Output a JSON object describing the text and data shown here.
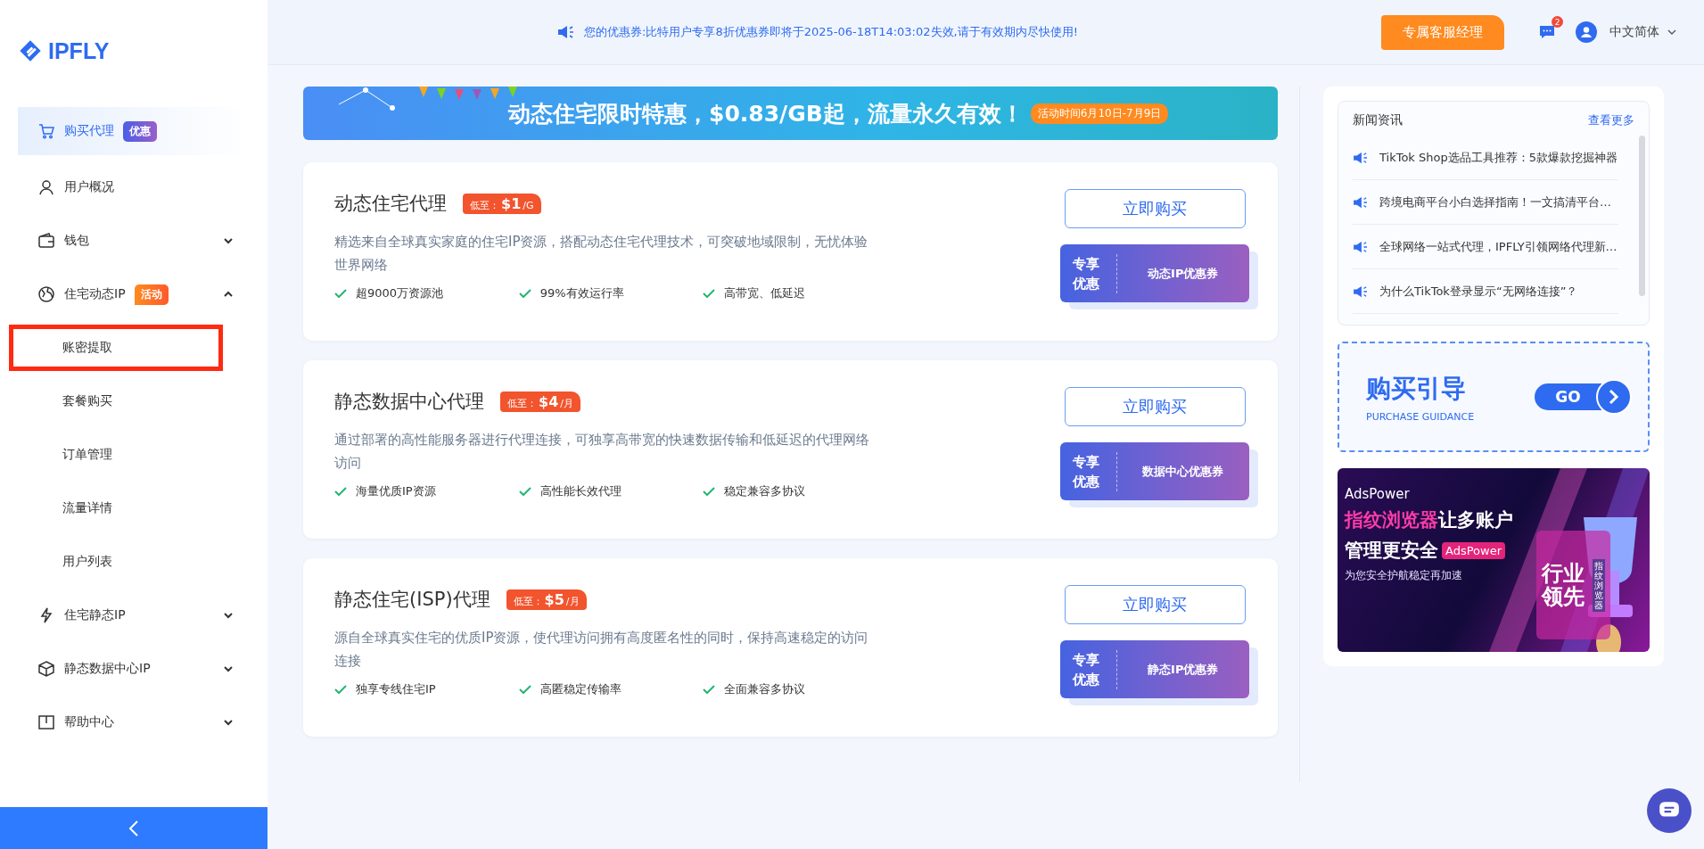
{
  "logo": {
    "text": "IPFLY"
  },
  "sidebar": {
    "items": [
      {
        "kind": "link",
        "label": "购买代理",
        "selected": true,
        "badge": {
          "text": "优惠",
          "kind": "purple"
        }
      },
      {
        "kind": "link",
        "label": "用户概况",
        "selected": false
      },
      {
        "kind": "group",
        "label": "钱包",
        "selected": false,
        "expanded": false
      },
      {
        "kind": "group",
        "label": "住宅动态IP",
        "selected": false,
        "expanded": true,
        "badge": {
          "text": "活动",
          "kind": "orange"
        },
        "children": [
          {
            "label": "账密提取",
            "selected": false,
            "highlighted": true
          },
          {
            "label": "套餐购买",
            "selected": false,
            "highlighted": false
          },
          {
            "label": "订单管理",
            "selected": false,
            "highlighted": false
          },
          {
            "label": "流量详情",
            "selected": false,
            "highlighted": false
          },
          {
            "label": "用户列表",
            "selected": false,
            "highlighted": false
          }
        ]
      },
      {
        "kind": "group",
        "label": "住宅静态IP",
        "selected": false,
        "expanded": false
      },
      {
        "kind": "group",
        "label": "静态数据中心IP",
        "selected": false,
        "expanded": false
      },
      {
        "kind": "group",
        "label": "帮助中心",
        "selected": false,
        "expanded": false
      }
    ]
  },
  "topbar": {
    "notice": "您的优惠券:比特用户专享8折优惠券即将于2025-06-18T14:03:02失效,请于有效期内尽快使用!",
    "manager_button": "专属客服经理",
    "message_count": "2",
    "language": "中文简体"
  },
  "promo_banner": {
    "headline": "动态住宅限时特惠，$0.83/GB起，流量永久有效！",
    "period": "活动时间6月10日-7月9日"
  },
  "products": [
    {
      "title": "动态住宅代理",
      "price_label": "低至：",
      "price": "$1",
      "price_unit": "/G",
      "description": "精选来自全球真实家庭的住宅IP资源，搭配动态住宅代理技术，可突破地域限制，无忧体验世界网络",
      "features": [
        "超9000万资源池",
        "99%有效运行率",
        "高带宽、低延迟"
      ],
      "buy_button": "立即购买",
      "coupon": {
        "tag": "专享优惠",
        "name": "动态IP优惠券"
      }
    },
    {
      "title": "静态数据中心代理",
      "price_label": "低至：",
      "price": "$4",
      "price_unit": "/月",
      "description": "通过部署的高性能服务器进行代理连接，可独享高带宽的快速数据传输和低延迟的代理网络访问",
      "features": [
        "海量优质IP资源",
        "高性能长效代理",
        "稳定兼容多协议"
      ],
      "buy_button": "立即购买",
      "coupon": {
        "tag": "专享优惠",
        "name": "数据中心优惠券"
      }
    },
    {
      "title": "静态住宅(ISP)代理",
      "price_label": "低至：",
      "price": "$5",
      "price_unit": "/月",
      "description": "源自全球真实住宅的优质IP资源，使代理访问拥有高度匿名性的同时，保持高速稳定的访问连接",
      "features": [
        "独享专线住宅IP",
        "高匿稳定传输率",
        "全面兼容多协议"
      ],
      "buy_button": "立即购买",
      "coupon": {
        "tag": "专享优惠",
        "name": "静态IP优惠券"
      }
    }
  ],
  "news": {
    "title": "新闻资讯",
    "more": "查看更多",
    "items": [
      "TikTok Shop选品工具推荐：5款爆款挖掘神器",
      "跨境电商平台小白选择指南！一文搞清平台…",
      "全球网络一站式代理，IPFLY引领网络代理新…",
      "为什么TikTok登录显示“无网络连接”？"
    ]
  },
  "guide": {
    "title": "购买引导",
    "subtitle": "PURCHASE GUIDANCE",
    "go": "GO"
  },
  "ad": {
    "brand": "AdsPower",
    "line1_highlight": "指纹浏览器",
    "line1_rest": "让多账户",
    "line2": "管理更安全",
    "line2_tag": "AdsPower",
    "line3": "为您安全护航稳定再加速",
    "side_title": "行业领先",
    "side_tag": "指纹浏览器"
  }
}
